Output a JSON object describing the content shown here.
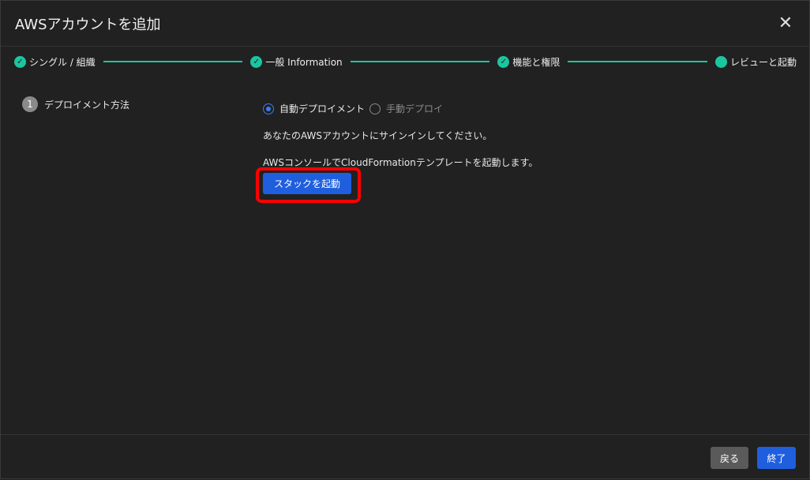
{
  "dialog": {
    "title": "AWSアカウントを追加",
    "close_icon": "close-icon"
  },
  "steps": [
    {
      "label": "シングル / 組織",
      "status": "complete"
    },
    {
      "label": "一般 Information",
      "status": "complete"
    },
    {
      "label": "機能と権限",
      "status": "complete"
    },
    {
      "label": "レビューと起動",
      "status": "current"
    }
  ],
  "section": {
    "number": "1",
    "title": "デプロイメント方法"
  },
  "deploy": {
    "options": [
      {
        "label": "自動デプロイメント",
        "selected": true
      },
      {
        "label": "手動デプロイ",
        "selected": false
      }
    ],
    "text1": "あなたのAWSアカウントにサインインしてください。",
    "text2": "AWSコンソールでCloudFormationテンプレートを起動します。",
    "launch_label": "スタックを起動"
  },
  "footer": {
    "back_label": "戻る",
    "finish_label": "終了"
  },
  "colors": {
    "accent": "#1ac6a0",
    "primary": "#1f5fde",
    "highlight": "#ff0000"
  }
}
